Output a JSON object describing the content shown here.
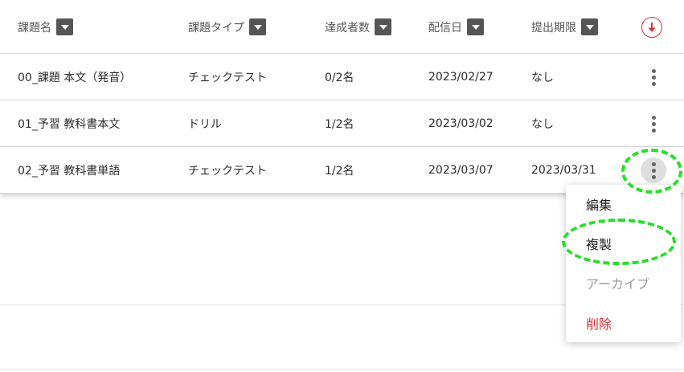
{
  "header": {
    "columns": [
      {
        "label": "課題名"
      },
      {
        "label": "課題タイプ"
      },
      {
        "label": "達成者数"
      },
      {
        "label": "配信日"
      },
      {
        "label": "提出期限"
      }
    ],
    "sort_icon": "arrow-down-circle-icon"
  },
  "rows": [
    {
      "name": "00_課題 本文（発音）",
      "type": "チェックテスト",
      "achievers": "0/2名",
      "delivery_date": "2023/02/27",
      "deadline": "なし"
    },
    {
      "name": "01_予習 教科書本文",
      "type": "ドリル",
      "achievers": "1/2名",
      "delivery_date": "2023/03/02",
      "deadline": "なし"
    },
    {
      "name": "02_予習 教科書単語",
      "type": "チェックテスト",
      "achievers": "1/2名",
      "delivery_date": "2023/03/07",
      "deadline": "2023/03/31"
    }
  ],
  "context_menu": {
    "items": [
      {
        "label": "編集"
      },
      {
        "label": "複製"
      },
      {
        "label": "アーカイブ"
      },
      {
        "label": "削除"
      }
    ]
  },
  "colors": {
    "accent_red": "#e03030",
    "annotation_green": "#24e024"
  }
}
